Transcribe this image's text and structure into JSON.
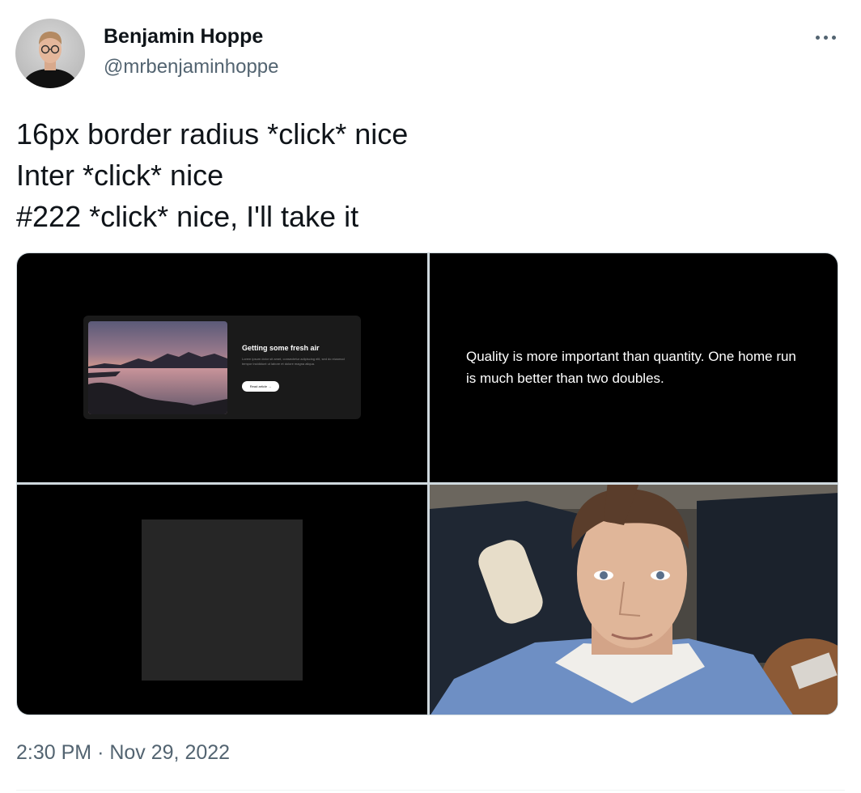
{
  "author": {
    "name": "Benjamin Hoppe",
    "handle": "@mrbenjaminhoppe"
  },
  "tweet": {
    "lines": [
      "16px border radius *click* nice",
      "Inter *click* nice",
      "#222 *click* nice, I'll take it"
    ],
    "time": "2:30 PM",
    "separator": "·",
    "date": "Nov 29, 2022"
  },
  "media": {
    "card": {
      "title": "Getting some fresh air",
      "description": "Lorem ipsum dolor sit amet, consectetur adipiscing elit, sed do eiusmod tempor incididunt ut labore et dolore magna aliqua.",
      "button_label": "Read article →"
    },
    "quote": "Quality is more important than quantity. One home run is much better than two doubles."
  },
  "icons": {
    "more": "more-horizontal-icon"
  },
  "colors": {
    "text_primary": "#0f1419",
    "text_secondary": "#536471",
    "media_background": "#000000",
    "card_background": "#1a1a1a",
    "placeholder_square": "#262626"
  }
}
